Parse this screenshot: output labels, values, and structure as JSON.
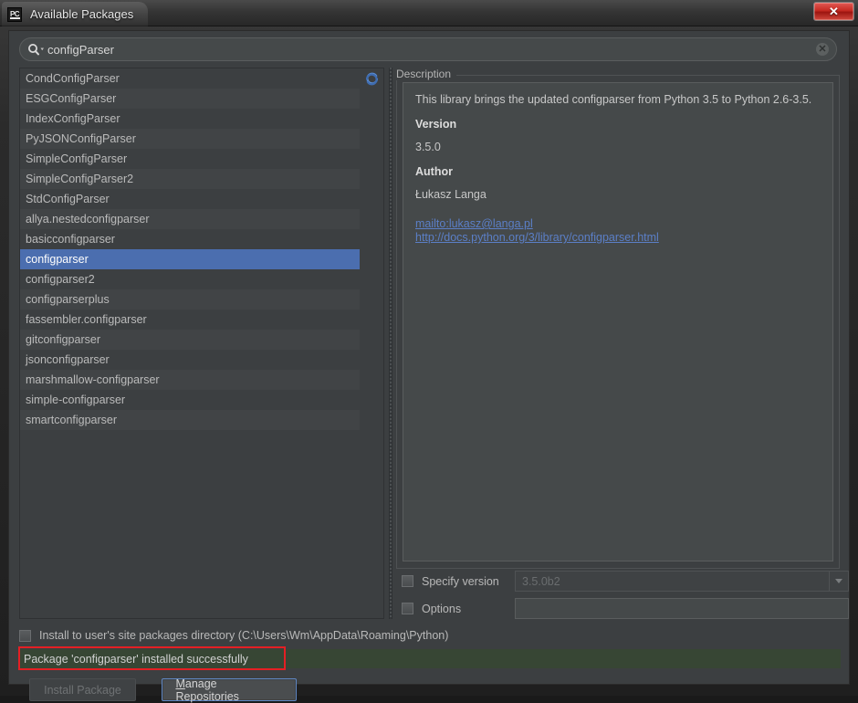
{
  "window": {
    "title": "Available Packages",
    "app_icon": "pycharm-pc-icon",
    "close_label": "✕"
  },
  "search": {
    "value": "configParser",
    "icon": "search-icon",
    "clear_icon": "✕"
  },
  "list": {
    "refresh_icon": "refresh-icon",
    "selected": "configparser",
    "items": [
      "CondConfigParser",
      "ESGConfigParser",
      "IndexConfigParser",
      "PyJSONConfigParser",
      "SimpleConfigParser",
      "SimpleConfigParser2",
      "StdConfigParser",
      "allya.nestedconfigparser",
      "basicconfigparser",
      "configparser",
      "configparser2",
      "configparserplus",
      "fassembler.configparser",
      "gitconfigparser",
      "jsonconfigparser",
      "marshmallow-configparser",
      "simple-configparser",
      "smartconfigparser"
    ]
  },
  "description": {
    "legend": "Description",
    "summary": "This library brings the updated configparser from Python 3.5 to Python 2.6-3.5.",
    "version_heading": "Version",
    "version_value": "3.5.0",
    "author_heading": "Author",
    "author_value": "Łukasz Langa",
    "links": [
      "mailto:lukasz@langa.pl",
      "http://docs.python.org/3/library/configparser.html"
    ]
  },
  "options": {
    "specify_version_label": "Specify version",
    "specify_version_checked": false,
    "version_combo_value": "3.5.0b2",
    "options_label": "Options",
    "options_checked": false,
    "options_value": "",
    "user_dir_label": "Install to user's site packages directory (C:\\Users\\Wm\\AppData\\Roaming\\Python)",
    "user_dir_checked": false
  },
  "status": {
    "message": "Package 'configparser' installed successfully",
    "bar_color": "#374634",
    "highlight_color": "#e41f24"
  },
  "buttons": {
    "install": "Install Package",
    "install_enabled": false,
    "manage_mnemonic": "M",
    "manage_rest": "anage Repositories"
  },
  "colors": {
    "selection_blue": "#4b6eaf",
    "link_blue": "#5b7fc7",
    "panel_bg": "#3c3f41",
    "field_bg": "#45494a"
  }
}
